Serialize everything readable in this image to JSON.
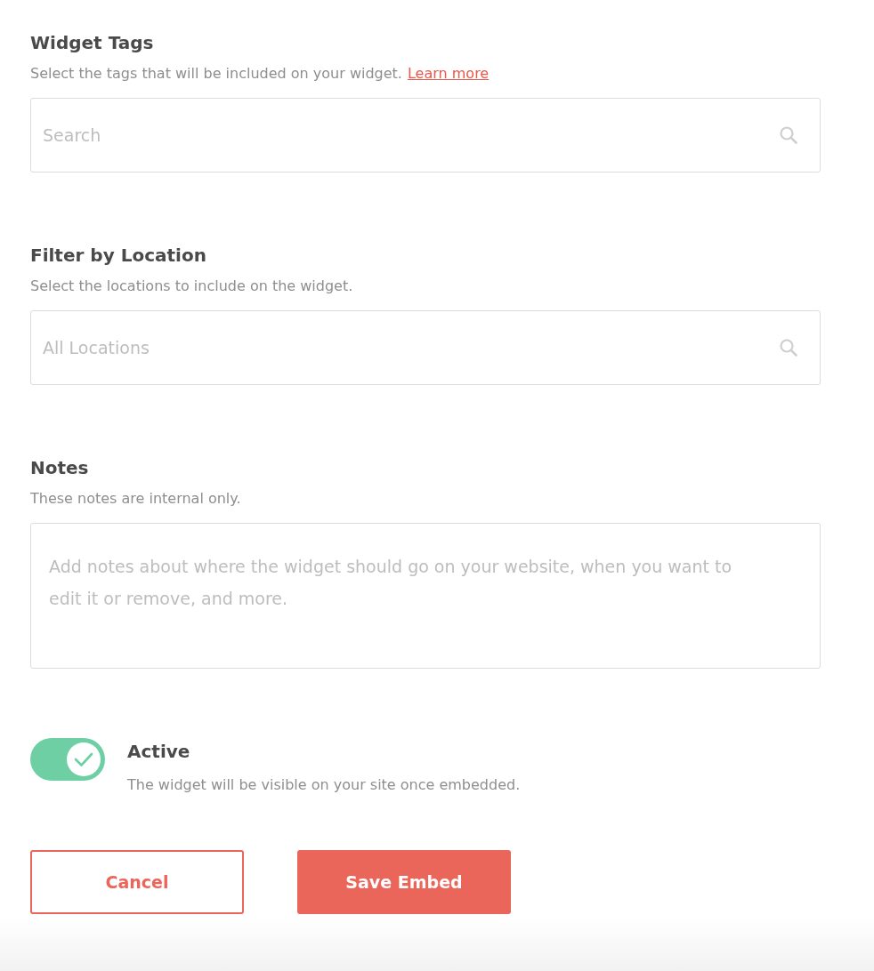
{
  "sections": [
    {
      "title": "Widget Tags",
      "description": "Select the tags that will be included on your widget.",
      "link": "Learn more",
      "field": {
        "kind": "search",
        "placeholder": "Search"
      }
    },
    {
      "title": "Filter by Location",
      "description": "Select the locations to include on the widget.",
      "field": {
        "kind": "search",
        "placeholder": "All Locations"
      }
    },
    {
      "title": "Notes",
      "description": "These notes are internal only.",
      "field": {
        "kind": "textarea",
        "placeholder": "Add notes about where the widget should go on your website, when you want to edit it or remove, and more."
      }
    }
  ],
  "active": {
    "on": true,
    "label": "Active",
    "description": "The widget will be visible on your site once embedded."
  },
  "buttons": [
    {
      "kind": "secondary",
      "label": "Cancel"
    },
    {
      "kind": "primary",
      "label": "Save Embed"
    }
  ]
}
